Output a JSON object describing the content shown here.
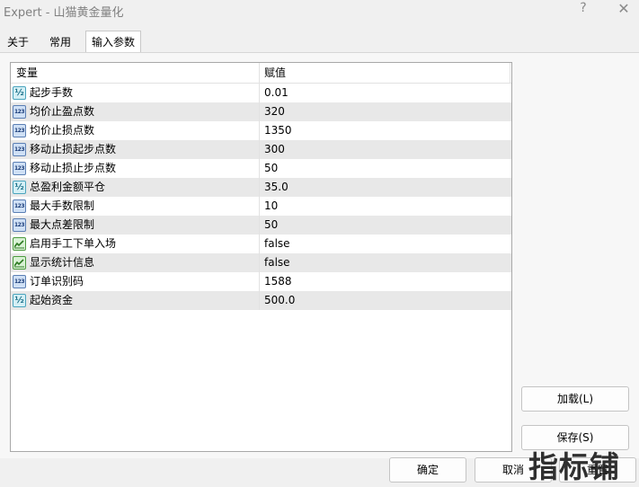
{
  "window": {
    "title": "Expert - 山猫黄金量化",
    "help_label": "?",
    "close_label": "✕"
  },
  "tabs": [
    {
      "label": "关于"
    },
    {
      "label": "常用"
    },
    {
      "label": "输入参数",
      "active": true
    }
  ],
  "grid": {
    "columns": {
      "name": "变量",
      "value": "赋值"
    },
    "rows": [
      {
        "type": "double",
        "icon": "double-type-icon",
        "name": "起步手数",
        "value": "0.01"
      },
      {
        "type": "int",
        "icon": "int-type-icon",
        "name": "均价止盈点数",
        "value": "320"
      },
      {
        "type": "int",
        "icon": "int-type-icon",
        "name": "均价止损点数",
        "value": "1350"
      },
      {
        "type": "int",
        "icon": "int-type-icon",
        "name": "移动止损起步点数",
        "value": "300"
      },
      {
        "type": "int",
        "icon": "int-type-icon",
        "name": "移动止损止步点数",
        "value": "50"
      },
      {
        "type": "double",
        "icon": "double-type-icon",
        "name": "总盈利金额平仓",
        "value": "35.0"
      },
      {
        "type": "int",
        "icon": "int-type-icon",
        "name": "最大手数限制",
        "value": "10"
      },
      {
        "type": "int",
        "icon": "int-type-icon",
        "name": "最大点差限制",
        "value": "50"
      },
      {
        "type": "bool",
        "icon": "bool-type-icon",
        "name": "启用手工下单入场",
        "value": "false"
      },
      {
        "type": "bool",
        "icon": "bool-type-icon",
        "name": "显示统计信息",
        "value": "false"
      },
      {
        "type": "int",
        "icon": "int-type-icon",
        "name": "订单识别码",
        "value": "1588"
      },
      {
        "type": "double",
        "icon": "double-type-icon",
        "name": "起始资金",
        "value": "500.0"
      }
    ]
  },
  "buttons": {
    "load": "加载(L)",
    "save": "保存(S)",
    "ok": "确定",
    "cancel": "取消",
    "reset": "重置"
  },
  "watermark": "指标铺",
  "colors": {
    "row_alt": "#e8e8e8",
    "int_icon": "#5b7fb4",
    "double_icon": "#4aa4bd",
    "bool_icon": "#4c9a3f"
  }
}
